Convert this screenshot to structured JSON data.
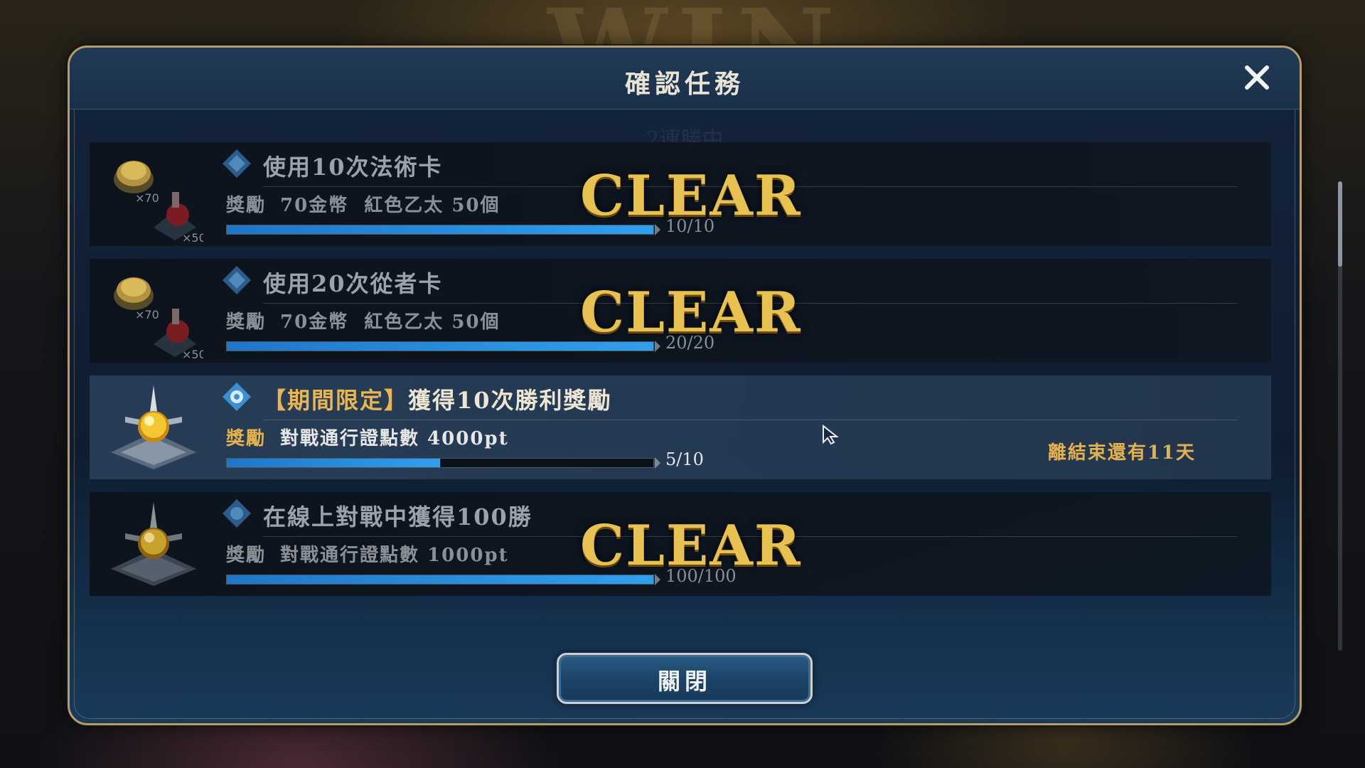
{
  "dialog": {
    "title": "確認任務",
    "ghost_text": "2連勝中",
    "close_button_label": "關閉"
  },
  "missions": [
    {
      "name": "使用10次法術卡",
      "reward_label": "獎勵",
      "reward_text": "70金幣  紅色乙太 50個",
      "progress_text": "10/10",
      "progress": 1.0,
      "status": "CLEAR",
      "icon": "coins-and-potion-icon",
      "coin_count": "×70",
      "potion_count": "×50"
    },
    {
      "name": "使用20次從者卡",
      "reward_label": "獎勵",
      "reward_text": "70金幣  紅色乙太 50個",
      "progress_text": "20/20",
      "progress": 1.0,
      "status": "CLEAR",
      "icon": "coins-and-potion-icon",
      "coin_count": "×70",
      "potion_count": "×50"
    },
    {
      "tag": "【期間限定】",
      "name": "獲得10次勝利獎勵",
      "reward_label": "獎勵",
      "reward_text": "對戰通行證點數 4000pt",
      "progress_text": "5/10",
      "progress": 0.5,
      "status": "",
      "days_left": "離結束還有11天",
      "icon": "battle-pass-orb-icon"
    },
    {
      "name": "在線上對戰中獲得100勝",
      "reward_label": "獎勵",
      "reward_text": "對戰通行證點數 1000pt",
      "progress_text": "100/100",
      "progress": 1.0,
      "status": "CLEAR",
      "icon": "battle-pass-orb-icon"
    }
  ],
  "colors": {
    "accent_gold": "#e8c251",
    "progress_blue": "#2fa0ee",
    "panel_blue": "#13233a"
  }
}
